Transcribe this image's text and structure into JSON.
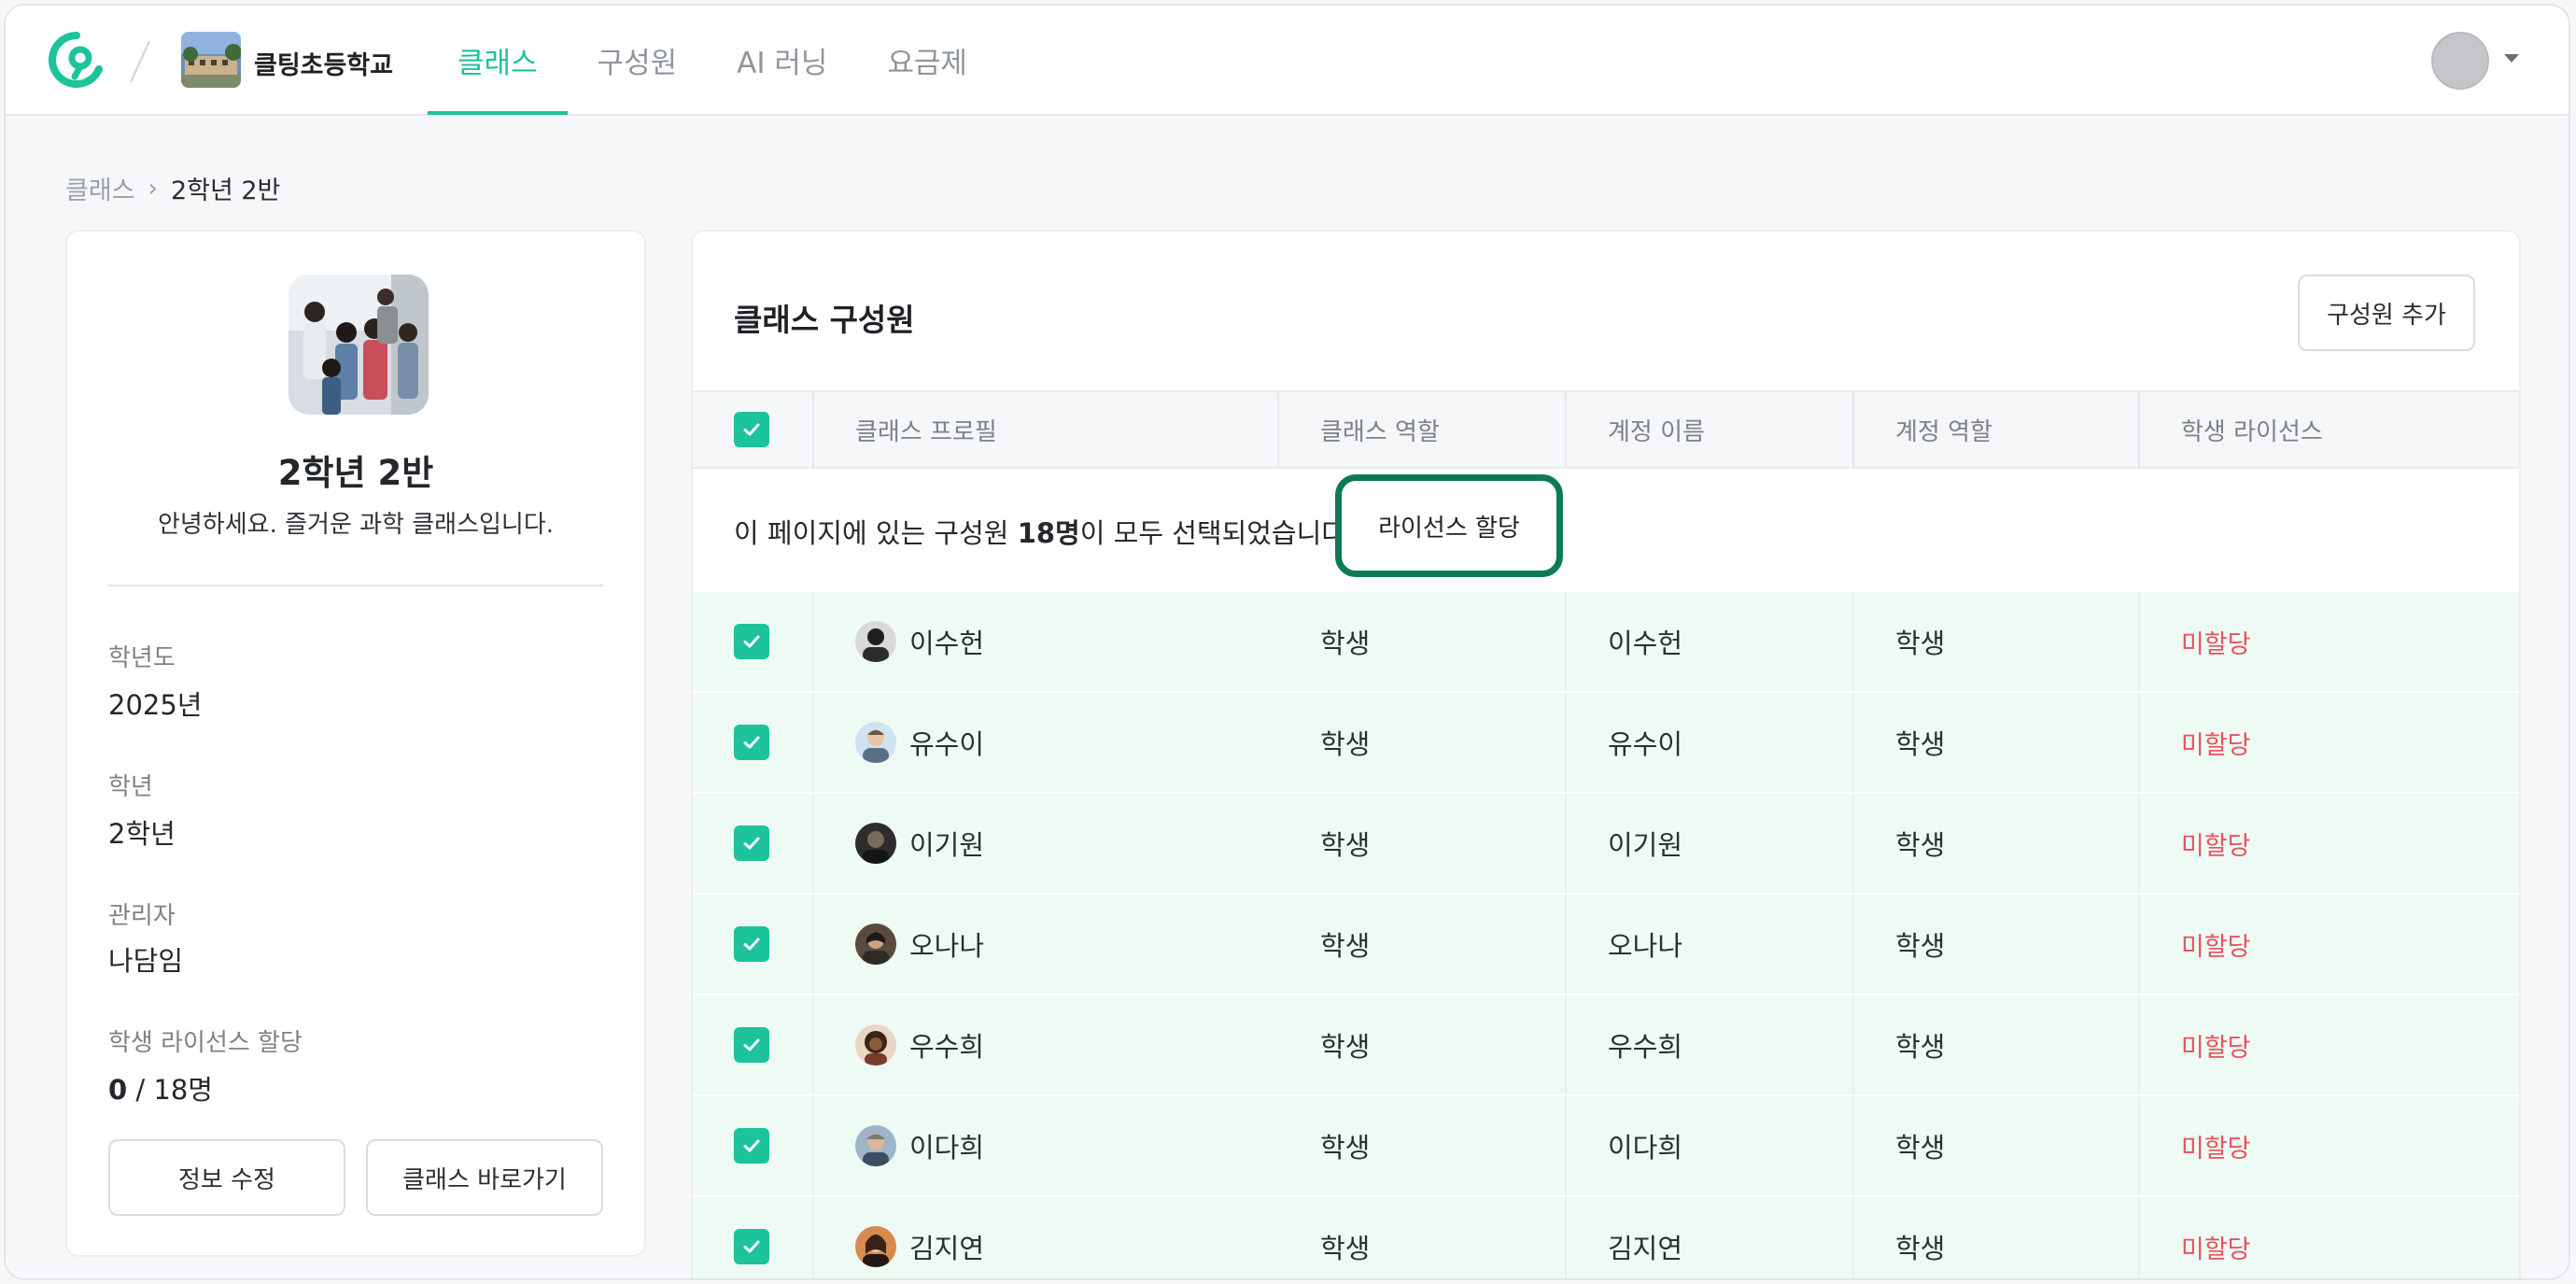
{
  "header": {
    "school_name": "클팅초등학교",
    "nav": [
      "클래스",
      "구성원",
      "AI 러닝",
      "요금제"
    ],
    "active_index": 0,
    "accent_color": "#1dc39a"
  },
  "breadcrumb": {
    "root": "클래스",
    "separator": "›",
    "current": "2학년 2반"
  },
  "class_info": {
    "name": "2학년 2반",
    "description": "안녕하세요. 즐거운 과학 클래스입니다.",
    "fields": [
      {
        "label": "학년도",
        "value": "2025년"
      },
      {
        "label": "학년",
        "value": "2학년"
      },
      {
        "label": "관리자",
        "value": "나담임"
      }
    ],
    "license_label": "학생 라이선스 할당",
    "license_assigned": "0",
    "license_total": " / 18명",
    "edit_button": "정보 수정",
    "goto_button": "클래스 바로가기"
  },
  "members_panel": {
    "title": "클래스 구성원",
    "add_button": "구성원 추가",
    "columns": [
      "클래스 프로필",
      "클래스 역할",
      "계정 이름",
      "계정 역할",
      "학생 라이선스"
    ],
    "banner_prefix": "이 페이지에 있는 구성원 ",
    "banner_count": "18명",
    "banner_suffix": "이 모두 선택되었습니다.",
    "assign_button": "라이선스 할당",
    "rows": [
      {
        "profile": "이수헌",
        "class_role": "학생",
        "account": "이수헌",
        "account_role": "학생",
        "license": "미할당"
      },
      {
        "profile": "유수이",
        "class_role": "학생",
        "account": "유수이",
        "account_role": "학생",
        "license": "미할당"
      },
      {
        "profile": "이기원",
        "class_role": "학생",
        "account": "이기원",
        "account_role": "학생",
        "license": "미할당"
      },
      {
        "profile": "오나나",
        "class_role": "학생",
        "account": "오나나",
        "account_role": "학생",
        "license": "미할당"
      },
      {
        "profile": "우수희",
        "class_role": "학생",
        "account": "우수희",
        "account_role": "학생",
        "license": "미할당"
      },
      {
        "profile": "이다희",
        "class_role": "학생",
        "account": "이다희",
        "account_role": "학생",
        "license": "미할당"
      },
      {
        "profile": "김지연",
        "class_role": "학생",
        "account": "김지연",
        "account_role": "학생",
        "license": "미할당"
      }
    ]
  }
}
